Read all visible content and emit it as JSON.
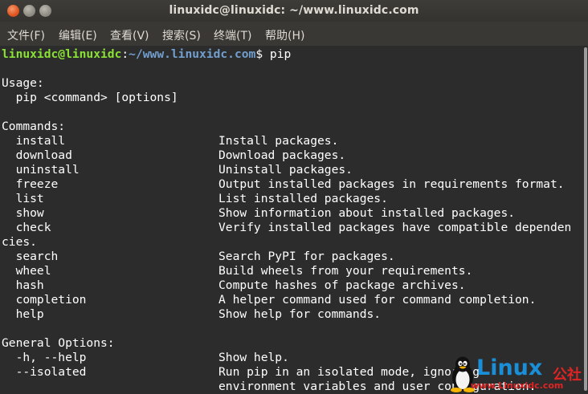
{
  "window": {
    "title": "linuxidc@linuxidc: ~/www.linuxidc.com"
  },
  "menu": [
    {
      "label": "文件(F)"
    },
    {
      "label": "编辑(E)"
    },
    {
      "label": "查看(V)"
    },
    {
      "label": "搜索(S)"
    },
    {
      "label": "终端(T)"
    },
    {
      "label": "帮助(H)"
    }
  ],
  "prompt": {
    "user": "linuxidc@linuxidc",
    "sep": ":",
    "path": "~/www.linuxidc.com",
    "symbol": "$ ",
    "command": "pip"
  },
  "output": {
    "usage_header": "Usage:",
    "usage_line": "  pip <command> [options]",
    "commands_header": "Commands:",
    "commands": [
      {
        "name": "  install",
        "desc": "Install packages."
      },
      {
        "name": "  download",
        "desc": "Download packages."
      },
      {
        "name": "  uninstall",
        "desc": "Uninstall packages."
      },
      {
        "name": "  freeze",
        "desc": "Output installed packages in requirements format."
      },
      {
        "name": "  list",
        "desc": "List installed packages."
      },
      {
        "name": "  show",
        "desc": "Show information about installed packages."
      },
      {
        "name": "  check",
        "desc": "Verify installed packages have compatible dependen"
      }
    ],
    "wrap_line": "cies.",
    "commands_more": [
      {
        "name": "  search",
        "desc": "Search PyPI for packages."
      },
      {
        "name": "  wheel",
        "desc": "Build wheels from your requirements."
      },
      {
        "name": "  hash",
        "desc": "Compute hashes of package archives."
      },
      {
        "name": "  completion",
        "desc": "A helper command used for command completion."
      },
      {
        "name": "  help",
        "desc": "Show help for commands."
      }
    ],
    "general_header": "General Options:",
    "options": [
      {
        "name": "  -h, --help",
        "desc": "Show help."
      },
      {
        "name": "  --isolated",
        "desc": "Run pip in an isolated mode, ignoring"
      },
      {
        "name": "",
        "desc": "environment variables and user configuration."
      }
    ]
  },
  "watermark": {
    "brand": "Linux",
    "suffix": "公社",
    "url": "www.Linuxidc.com"
  }
}
